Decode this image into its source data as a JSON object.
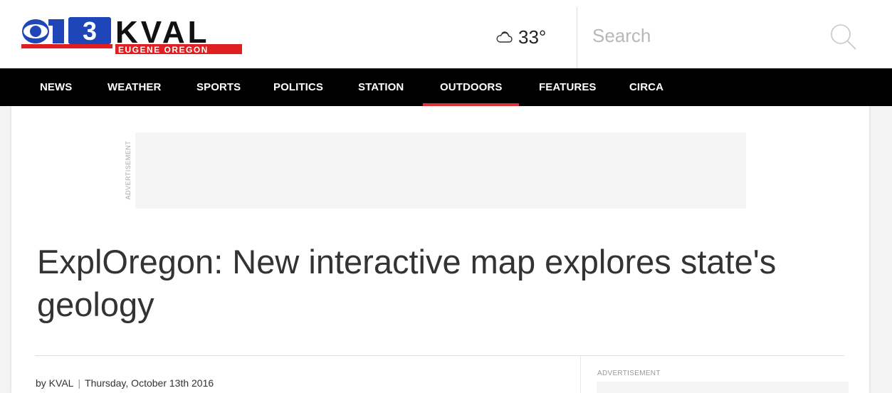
{
  "header": {
    "logo": {
      "channel_number": "13",
      "station_name": "KVAL",
      "station_location": "EUGENE OREGON",
      "brand_colors": {
        "blue": "#1f46b8",
        "red": "#e02020",
        "black": "#111111"
      }
    },
    "weather": {
      "icon": "cloud-icon",
      "temperature": "33°"
    },
    "search": {
      "placeholder": "Search",
      "value": "",
      "icon": "search-icon"
    }
  },
  "nav": {
    "items": [
      {
        "label": "NEWS"
      },
      {
        "label": "WEATHER"
      },
      {
        "label": "SPORTS"
      },
      {
        "label": "POLITICS"
      },
      {
        "label": "STATION"
      },
      {
        "label": "OUTDOORS",
        "active": true
      },
      {
        "label": "FEATURES"
      },
      {
        "label": "CIRCA"
      }
    ],
    "active_color": "#e3313b"
  },
  "ads": {
    "top_label": "ADVERTISEMENT",
    "side_label": "ADVERTISEMENT"
  },
  "article": {
    "headline": "ExplOregon: New interactive map explores state's geology",
    "author": "by KVAL",
    "separator": "|",
    "date": "Thursday, October 13th 2016"
  }
}
